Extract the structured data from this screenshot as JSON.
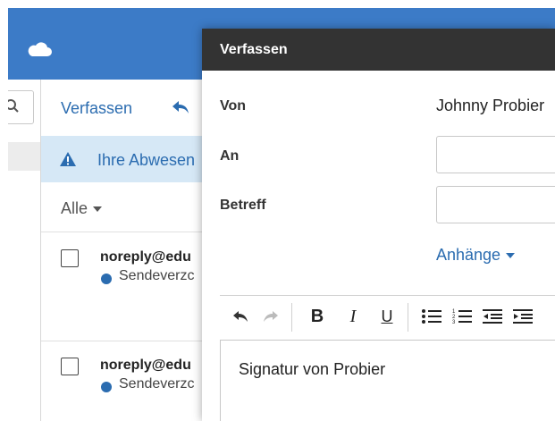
{
  "app": {
    "brand_color": "#3c7bc7",
    "icons": [
      "cloud-icon",
      "search-icon",
      "reply-icon",
      "warning-icon"
    ]
  },
  "mail": {
    "toolbar": {
      "compose_label": "Verfassen"
    },
    "banner": {
      "text": "Ihre Abwesen"
    },
    "filter": {
      "label": "Alle"
    },
    "items": [
      {
        "sender": "noreply@edu",
        "folder": "Sendeverzc"
      },
      {
        "sender": "noreply@edu",
        "folder": "Sendeverzc"
      }
    ]
  },
  "compose": {
    "title": "Verfassen",
    "from_label": "Von",
    "from_value": "Johnny Probier",
    "to_label": "An",
    "subject_label": "Betreff",
    "attachments_label": "Anhänge",
    "editor_text": "Signatur von Probier",
    "toolbar_icons": [
      "undo-icon",
      "redo-icon",
      "bold-icon",
      "italic-icon",
      "underline-icon",
      "bullet-list-icon",
      "numbered-list-icon",
      "outdent-icon",
      "indent-icon"
    ]
  }
}
